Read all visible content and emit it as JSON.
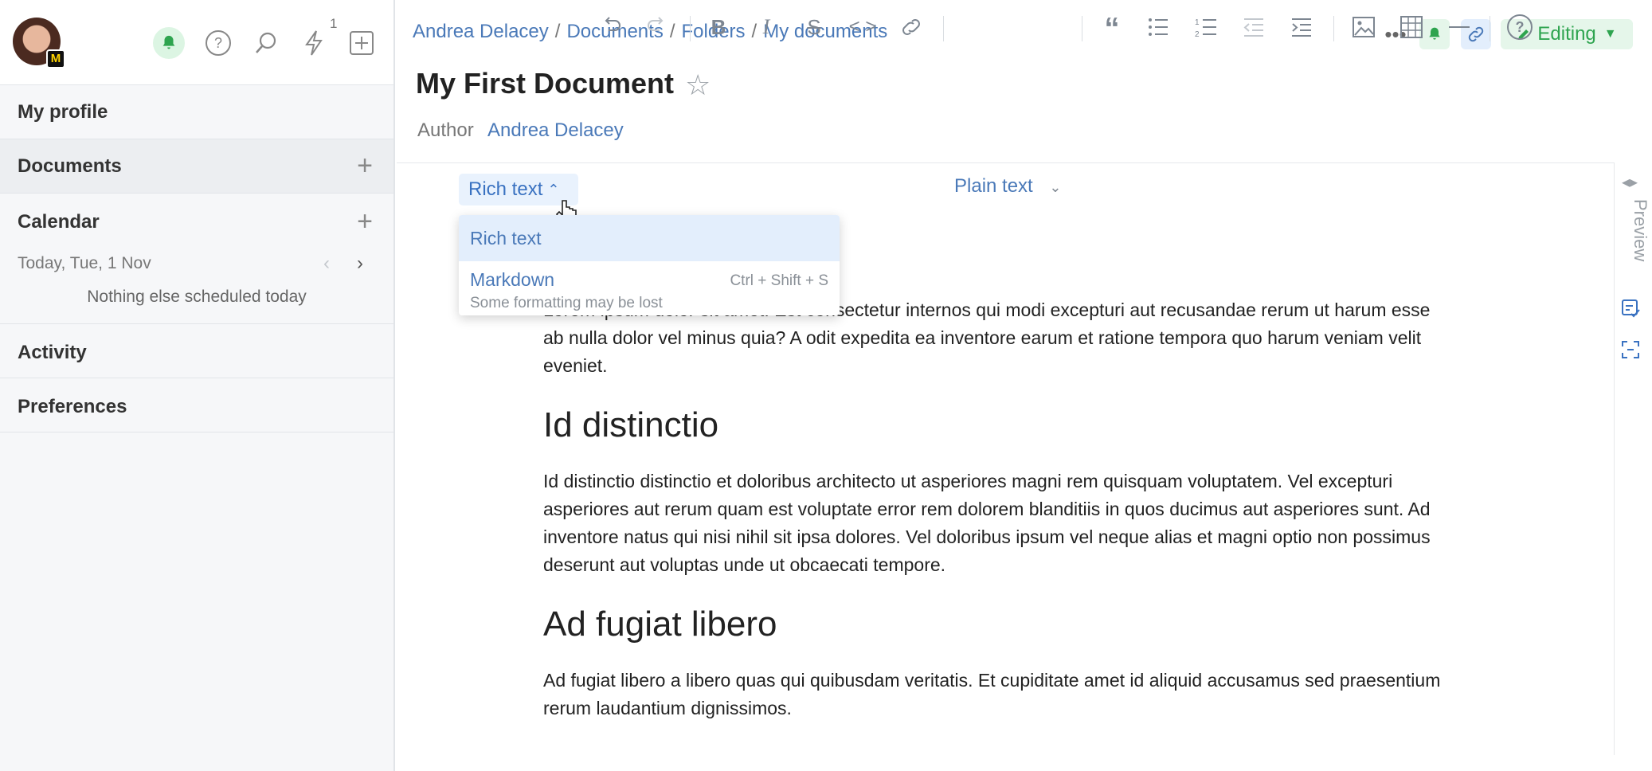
{
  "sidebar": {
    "notification_count": "1",
    "items": [
      {
        "label": "My profile"
      },
      {
        "label": "Documents"
      },
      {
        "label": "Calendar"
      },
      {
        "label": "Activity"
      },
      {
        "label": "Preferences"
      }
    ],
    "calendar": {
      "date_label": "Today, Tue, 1 Nov",
      "empty_message": "Nothing else scheduled today"
    },
    "avatar_badge": "M"
  },
  "breadcrumb": [
    "Andrea Delacey",
    "Documents",
    "Folders",
    "My documents"
  ],
  "breadcrumb_separator": "/",
  "document": {
    "title": "My First Document",
    "author_label": "Author",
    "author_name": "Andrea Delacey"
  },
  "top_actions": {
    "editing_label": "Editing"
  },
  "toolbar": {
    "mode_label": "Rich text",
    "block_style": "Plain text"
  },
  "mode_menu": {
    "options": [
      {
        "label": "Rich text"
      },
      {
        "label": "Markdown",
        "shortcut": "Ctrl + Shift + S",
        "hint": "Some formatting may be lost"
      }
    ]
  },
  "right_rail": {
    "preview_label": "Preview"
  },
  "content": {
    "p1": "Lorem ipsum dolor sit amet. Est consectetur internos qui modi excepturi aut recusandae rerum ut harum esse ab nulla dolor vel minus quia? A odit expedita ea inventore earum et ratione tempora quo harum veniam velit eveniet.",
    "h1": "Id distinctio",
    "p2": "Id distinctio distinctio et doloribus architecto ut asperiores magni rem quisquam voluptatem. Vel excepturi asperiores aut rerum quam est voluptate error rem dolorem blanditiis in quos ducimus aut asperiores sunt. Ad inventore natus qui nisi nihil sit ipsa dolores. Vel doloribus ipsum vel neque alias et magni optio non possimus deserunt aut voluptas unde ut obcaecati tempore.",
    "h2": "Ad fugiat libero",
    "p3": "Ad fugiat libero a libero quas qui quibusdam veritatis. Et cupiditate amet id aliquid accusamus sed praesentium rerum laudantium dignissimos."
  },
  "colors": {
    "accent_blue": "#4a79b8",
    "editing_green": "#2ea44f",
    "sidebar_bg": "#f6f7f9"
  }
}
